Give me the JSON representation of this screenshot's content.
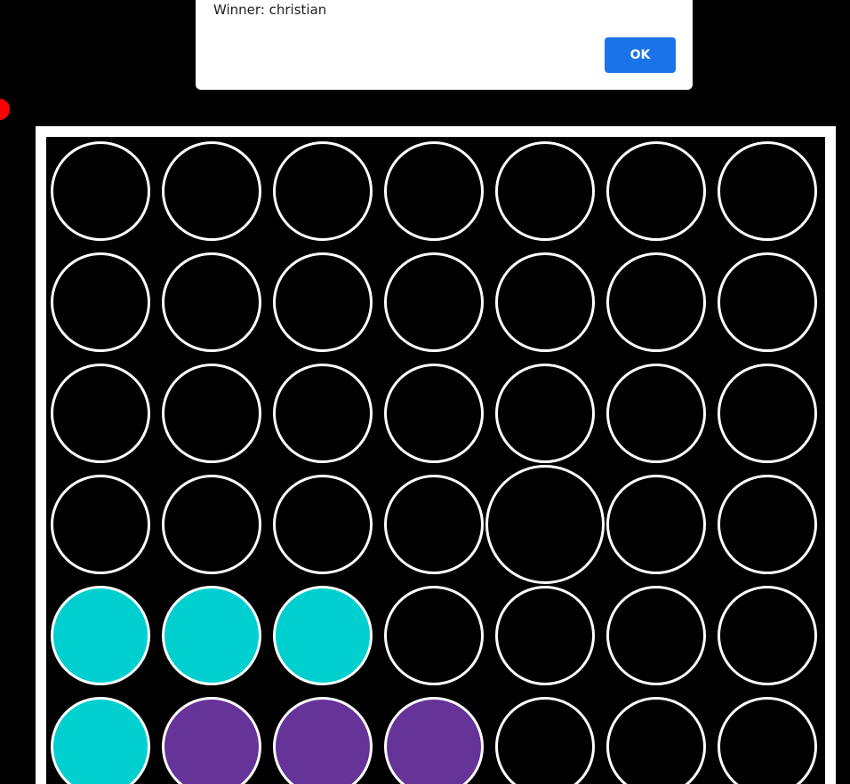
{
  "dialog": {
    "message": "Winner: christian",
    "ok_label": "OK"
  },
  "colors": {
    "background": "#000000",
    "board_frame": "#ffffff",
    "empty": "#000000",
    "player_teal": "#00cfd0",
    "player_purple": "#663399",
    "turn_indicator": "#ff0000",
    "ok_button": "#1a73e8"
  },
  "board": {
    "columns": 7,
    "highlighted_cell": {
      "row": 3,
      "col": 4
    },
    "rows": [
      [
        "empty",
        "empty",
        "empty",
        "empty",
        "empty",
        "empty",
        "empty"
      ],
      [
        "empty",
        "empty",
        "empty",
        "empty",
        "empty",
        "empty",
        "empty"
      ],
      [
        "empty",
        "empty",
        "empty",
        "empty",
        "empty",
        "empty",
        "empty"
      ],
      [
        "empty",
        "empty",
        "empty",
        "empty",
        "empty",
        "empty",
        "empty"
      ],
      [
        "teal",
        "teal",
        "teal",
        "empty",
        "empty",
        "empty",
        "empty"
      ],
      [
        "teal",
        "purple",
        "purple",
        "purple",
        "empty",
        "empty",
        "empty"
      ]
    ]
  }
}
